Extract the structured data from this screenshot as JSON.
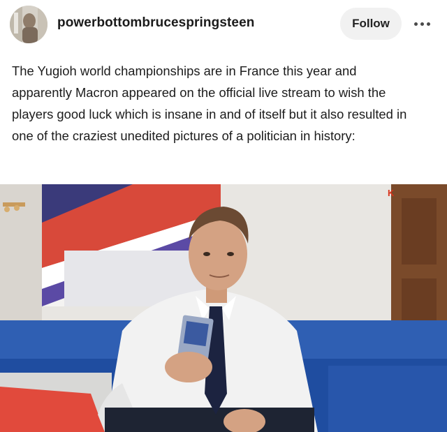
{
  "header": {
    "username": "powerbottombrucespringsteen",
    "follow_label": "Follow",
    "more_icon": "ellipsis-icon"
  },
  "post": {
    "lines": [
      "The Yugioh world championships are in France this year and",
      "apparently Macron appeared on the official live stream to wish the",
      "players good luck which is insane in and of itself but it also resulted in",
      "one of the craziest unedited pictures of a politician in history:"
    ]
  },
  "image": {
    "watermark": "K"
  }
}
